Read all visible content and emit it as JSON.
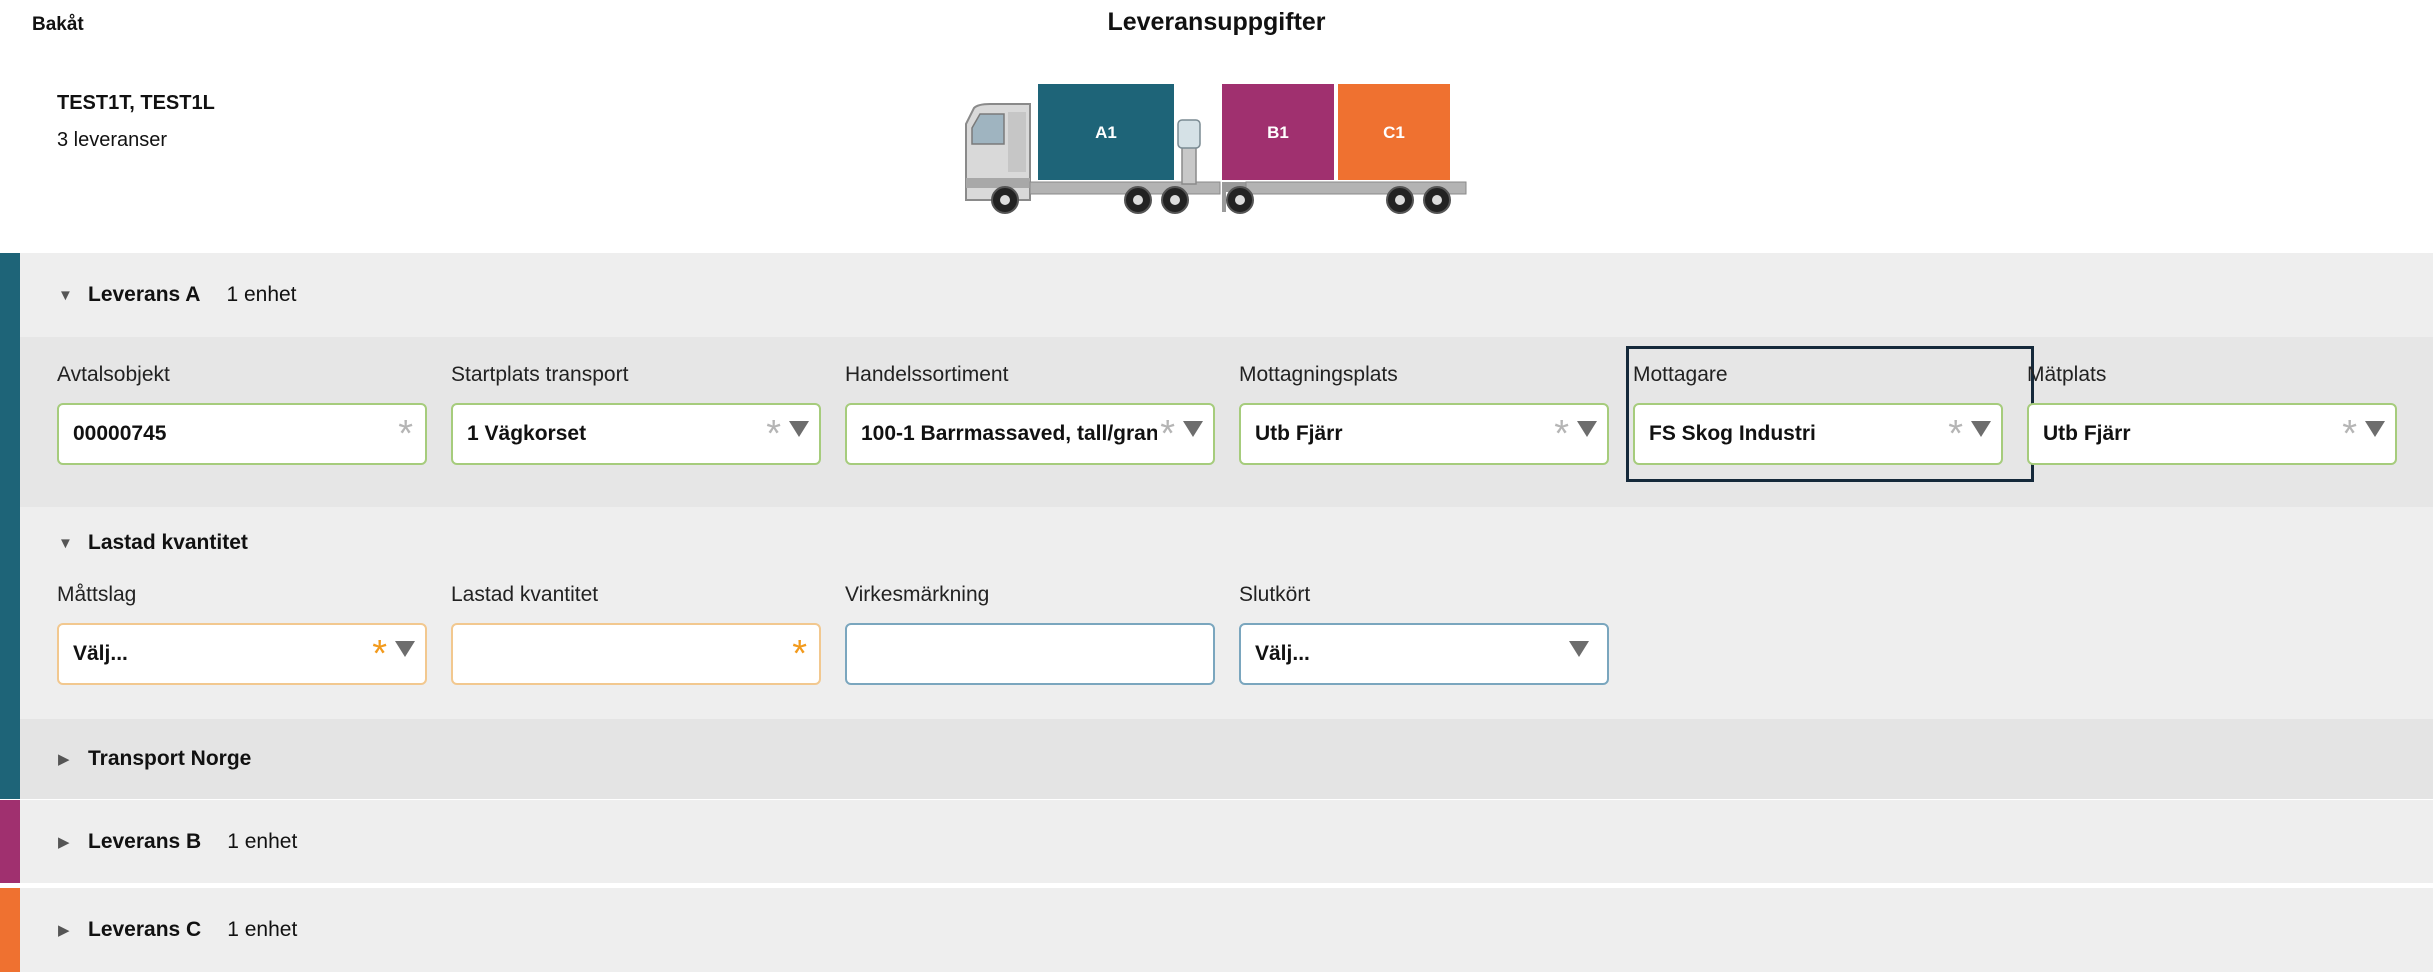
{
  "header": {
    "back_label": "Bakåt",
    "title": "Leveransuppgifter"
  },
  "vehicle": {
    "id": "TEST1T, TEST1L",
    "deliveries": "3 leveranser",
    "containers": [
      {
        "label": "A1",
        "color": "#1e6478"
      },
      {
        "label": "B1",
        "color": "#a0306f"
      },
      {
        "label": "C1",
        "color": "#ef7130"
      }
    ]
  },
  "colors": {
    "leverans_a": "#1e6478",
    "leverans_b": "#a0306f",
    "leverans_c": "#ef7130",
    "required_grey": "#b5b5b5",
    "required_orange": "#f29a1c"
  },
  "leverans_a": {
    "title": "Leverans A",
    "count": "1 enhet",
    "fields": [
      {
        "label": "Avtalsobjekt",
        "value": "00000745"
      },
      {
        "label": "Startplats transport",
        "value": "1 Vägkorset"
      },
      {
        "label": "Handelssortiment",
        "value": "100-1 Barrmassaved, tall/gran"
      },
      {
        "label": "Mottagningsplats",
        "value": "Utb Fjärr"
      },
      {
        "label": "Mottagare",
        "value": "FS Skog Industri"
      },
      {
        "label": "Mätplats",
        "value": "Utb Fjärr"
      }
    ]
  },
  "lastad_kvantitet": {
    "title": "Lastad kvantitet",
    "fields": [
      {
        "label": "Måttslag",
        "value": "Välj..."
      },
      {
        "label": "Lastad kvantitet",
        "value": ""
      },
      {
        "label": "Virkesmärkning",
        "value": ""
      },
      {
        "label": "Slutkört",
        "value": "Välj..."
      }
    ]
  },
  "transport_norge": {
    "title": "Transport Norge"
  },
  "leverans_b": {
    "title": "Leverans B",
    "count": "1 enhet"
  },
  "leverans_c": {
    "title": "Leverans C",
    "count": "1 enhet"
  },
  "required_mark": "*"
}
